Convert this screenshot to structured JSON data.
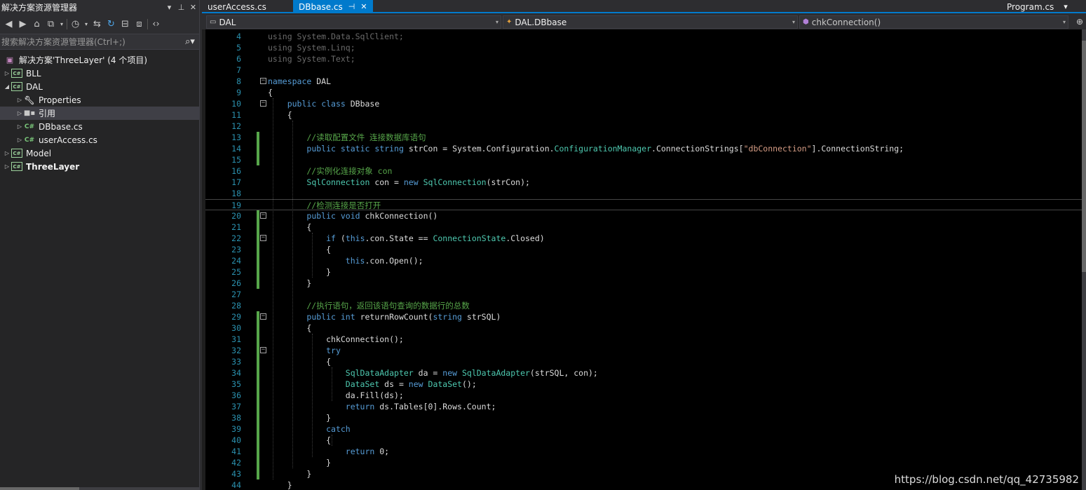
{
  "solution_explorer": {
    "title": "解决方案资源管理器",
    "search_placeholder": "搜索解决方案资源管理器(Ctrl+;)",
    "tree": [
      {
        "label": "解决方案'ThreeLayer' (4 个项目)",
        "icon": "solution-icon",
        "expanded": true
      },
      {
        "label": "BLL",
        "icon": "csharp-project-icon",
        "expanded": false
      },
      {
        "label": "DAL",
        "icon": "csharp-project-icon",
        "expanded": true
      },
      {
        "label": "Properties",
        "icon": "wrench-icon",
        "expanded": false
      },
      {
        "label": "引用",
        "icon": "references-icon",
        "expanded": false,
        "selected": true
      },
      {
        "label": "DBbase.cs",
        "icon": "csharp-file-icon",
        "expanded": false
      },
      {
        "label": "userAccess.cs",
        "icon": "csharp-file-icon",
        "expanded": false
      },
      {
        "label": "Model",
        "icon": "csharp-project-icon",
        "expanded": false
      },
      {
        "label": "ThreeLayer",
        "icon": "csharp-project-icon",
        "expanded": false,
        "bold": true
      }
    ]
  },
  "tabs": {
    "items": [
      "userAccess.cs",
      "DBbase.cs"
    ],
    "active": "DBbase.cs",
    "preview": "Program.cs"
  },
  "navbar": {
    "project": "DAL",
    "class": "DAL.DBbase",
    "member": "chkConnection()"
  },
  "code": {
    "line_numbers": [
      "4",
      "5",
      "6",
      "7",
      "8",
      "9",
      "10",
      "11",
      "12",
      "13",
      "14",
      "15",
      "16",
      "17",
      "18",
      "19",
      "20",
      "21",
      "22",
      "23",
      "24",
      "25",
      "26",
      "27",
      "28",
      "29",
      "30",
      "31",
      "32",
      "33",
      "34",
      "35",
      "36",
      "37",
      "38",
      "39",
      "40",
      "41",
      "42",
      "43",
      "44"
    ],
    "lines": [
      "using System.Data.SqlClient;",
      "using System.Linq;",
      "using System.Text;",
      "",
      "namespace DAL",
      "{",
      "    public class DBbase",
      "    {",
      "",
      "        //读取配置文件 连接数据库语句",
      "        public static string strCon = System.Configuration.ConfigurationManager.ConnectionStrings[\"dbConnection\"].ConnectionString;",
      "",
      "        //实例化连接对象 con",
      "        SqlConnection con = new SqlConnection(strCon);",
      "",
      "        //检测连接是否打开",
      "        public void chkConnection()",
      "        {",
      "            if (this.con.State == ConnectionState.Closed)",
      "            {",
      "                this.con.Open();",
      "            }",
      "        }",
      "",
      "        //执行语句，返回该语句查询的数据行的总数",
      "        public int returnRowCount(string strSQL)",
      "        {",
      "            chkConnection();",
      "            try",
      "            {",
      "                SqlDataAdapter da = new SqlDataAdapter(strSQL, con);",
      "                DataSet ds = new DataSet();",
      "                da.Fill(ds);",
      "                return ds.Tables[0].Rows.Count;",
      "            }",
      "            catch",
      "            {",
      "                return 0;",
      "            }",
      "        }",
      "    }"
    ]
  },
  "watermark": "https://blog.csdn.net/qq_42735982",
  "colors": {
    "keyword": "#569cd6",
    "type": "#4ec9b0",
    "string": "#d69d85",
    "comment": "#57a64a",
    "line_number": "#2b91af",
    "accent": "#007acc"
  }
}
